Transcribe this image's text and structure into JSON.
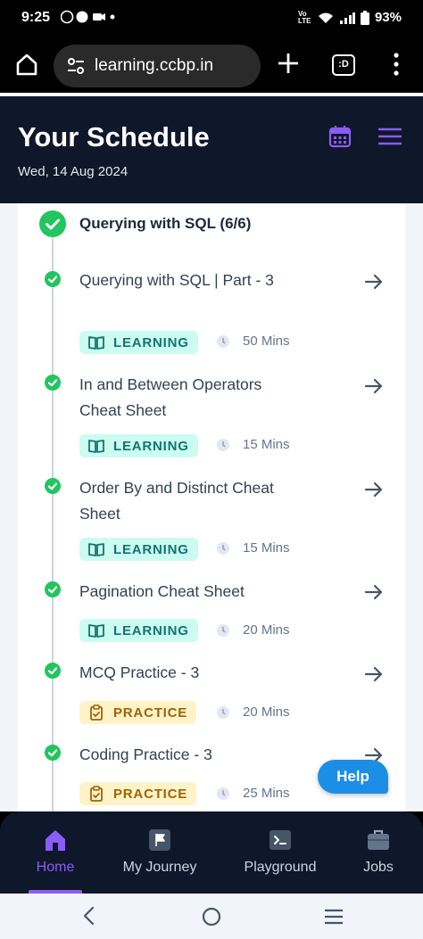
{
  "status_bar": {
    "time": "9:25",
    "battery": "93%",
    "network": "Vo LTE"
  },
  "browser": {
    "url": "learning.ccbp.in",
    "tabs_label": ":D"
  },
  "header": {
    "title": "Your Schedule",
    "date": "Wed, 14 Aug 2024"
  },
  "section": {
    "title": "Querying with SQL (6/6)"
  },
  "items": [
    {
      "title": "Querying with SQL | Part - 3",
      "type": "LEARNING",
      "duration": "50 Mins"
    },
    {
      "title": "In and Between Operators Cheat Sheet",
      "type": "LEARNING",
      "duration": "15 Mins"
    },
    {
      "title": "Order By and Distinct Cheat Sheet",
      "type": "LEARNING",
      "duration": "15 Mins"
    },
    {
      "title": "Pagination Cheat Sheet",
      "type": "LEARNING",
      "duration": "20 Mins"
    },
    {
      "title": "MCQ Practice - 3",
      "type": "PRACTICE",
      "duration": "20 Mins"
    },
    {
      "title": "Coding Practice - 3",
      "type": "PRACTICE",
      "duration": "25 Mins"
    }
  ],
  "help_label": "Help",
  "nav": [
    {
      "label": "Home",
      "icon": "home-icon",
      "active": true
    },
    {
      "label": "My Journey",
      "icon": "flag-icon",
      "active": false
    },
    {
      "label": "Playground",
      "icon": "terminal-icon",
      "active": false
    },
    {
      "label": "Jobs",
      "icon": "briefcase-icon",
      "active": false
    }
  ],
  "colors": {
    "header_bg": "#0f172a",
    "accent": "#8b5cf6",
    "check_green": "#22c55e",
    "learning_bg": "#ccfbf1",
    "learning_text": "#0f766e",
    "practice_bg": "#fef3c7",
    "practice_text": "#a16207",
    "help_button": "#1d8ee6"
  }
}
